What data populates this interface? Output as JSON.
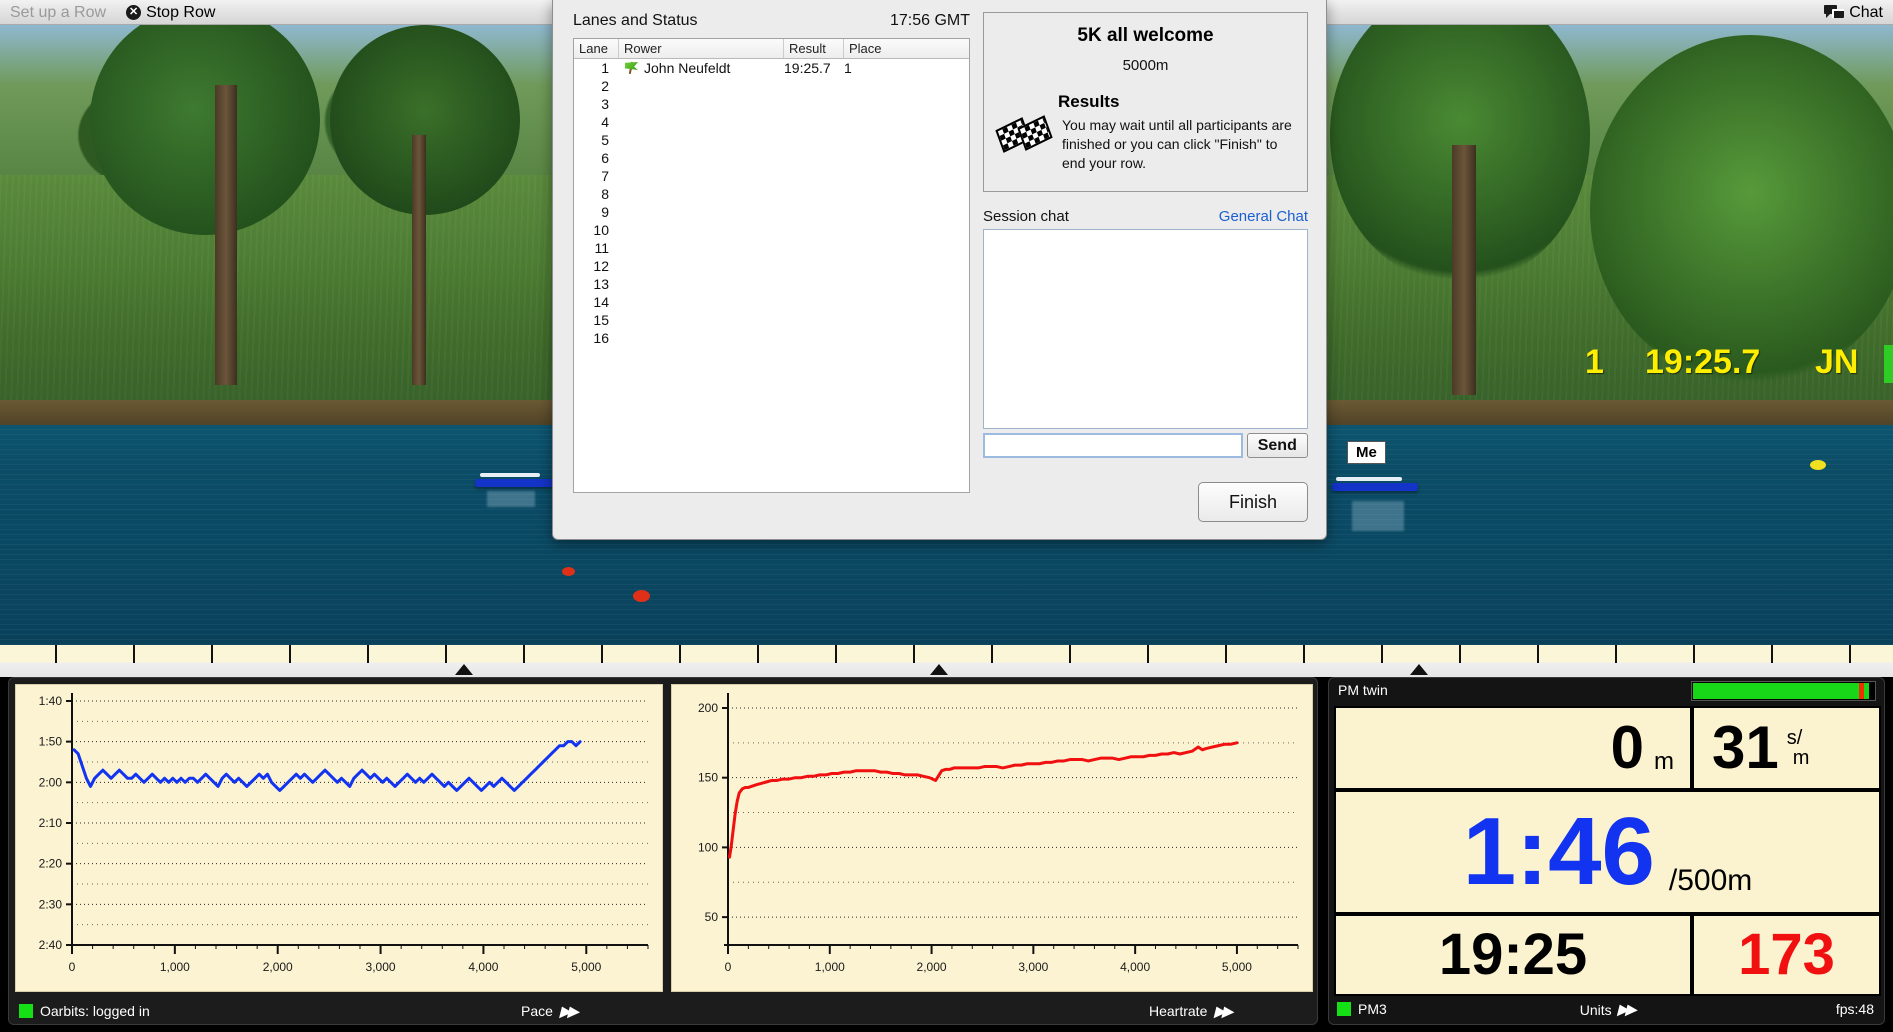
{
  "toolbar": {
    "setup_label": "Set up a Row",
    "stop_label": "Stop Row",
    "stop_icon": "close-circle-icon",
    "chat_label": "Chat",
    "chat_icon": "speech-bubble-icon"
  },
  "scene": {
    "overlay_place": "1",
    "overlay_time": "19:25.7",
    "overlay_initials": "JN",
    "me_label": "Me"
  },
  "dialog": {
    "lanes_title": "Lanes and Status",
    "clock": "17:56 GMT",
    "columns": [
      "Lane",
      "Rower",
      "Result",
      "Place"
    ],
    "rows": [
      {
        "lane": "1",
        "rower": "John Neufeldt",
        "result": "19:25.7",
        "place": "1",
        "flag": "green-flag-icon"
      },
      {
        "lane": "2",
        "rower": "",
        "result": "",
        "place": "",
        "flag": ""
      },
      {
        "lane": "3",
        "rower": "",
        "result": "",
        "place": "",
        "flag": ""
      },
      {
        "lane": "4",
        "rower": "",
        "result": "",
        "place": "",
        "flag": ""
      },
      {
        "lane": "5",
        "rower": "",
        "result": "",
        "place": "",
        "flag": ""
      },
      {
        "lane": "6",
        "rower": "",
        "result": "",
        "place": "",
        "flag": ""
      },
      {
        "lane": "7",
        "rower": "",
        "result": "",
        "place": "",
        "flag": ""
      },
      {
        "lane": "8",
        "rower": "",
        "result": "",
        "place": "",
        "flag": ""
      },
      {
        "lane": "9",
        "rower": "",
        "result": "",
        "place": "",
        "flag": ""
      },
      {
        "lane": "10",
        "rower": "",
        "result": "",
        "place": "",
        "flag": ""
      },
      {
        "lane": "11",
        "rower": "",
        "result": "",
        "place": "",
        "flag": ""
      },
      {
        "lane": "12",
        "rower": "",
        "result": "",
        "place": "",
        "flag": ""
      },
      {
        "lane": "13",
        "rower": "",
        "result": "",
        "place": "",
        "flag": ""
      },
      {
        "lane": "14",
        "rower": "",
        "result": "",
        "place": "",
        "flag": ""
      },
      {
        "lane": "15",
        "rower": "",
        "result": "",
        "place": "",
        "flag": ""
      },
      {
        "lane": "16",
        "rower": "",
        "result": "",
        "place": "",
        "flag": ""
      }
    ],
    "race_title": "5K all welcome",
    "race_distance": "5000m",
    "results_heading": "Results",
    "results_text": "You may wait until all participants are finished or you can click \"Finish\" to end your row.",
    "results_icon": "checkered-flags-icon",
    "session_chat_label": "Session chat",
    "general_chat_label": "General Chat",
    "chat_log_text": "",
    "chat_input_value": "",
    "chat_input_placeholder": "",
    "send_label": "Send",
    "finish_label": "Finish"
  },
  "charts": {
    "pace_footer_label": "Pace",
    "heartrate_footer_label": "Heartrate",
    "status_label": "Oarbits: logged in",
    "status_icon": "green-status-square",
    "forward_icon": "double-arrow-icon"
  },
  "pm": {
    "title": "PM twin",
    "distance_value": "0",
    "distance_unit": "m",
    "rate_value": "31",
    "rate_unit_top": "s/",
    "rate_unit_bottom": "m",
    "pace_value": "1:46",
    "pace_unit": "/500m",
    "time_value": "19:25",
    "hr_value": "173",
    "footer_device": "PM3",
    "footer_units": "Units",
    "footer_fps": "fps:48",
    "footer_icon": "green-status-square",
    "units_icon": "double-arrow-icon",
    "bar_fill_percent": 96,
    "colors": {
      "pace": "#1233f0",
      "hr": "#f01010",
      "bar": "#18d718",
      "mark": "#f03000"
    }
  },
  "chart_data": [
    {
      "type": "line",
      "title": "Pace",
      "xlabel": "",
      "ylabel": "",
      "xlim": [
        0,
        5600
      ],
      "ylim": [
        100,
        160
      ],
      "y_inverted": true,
      "grid": true,
      "legend": null,
      "color": "#1233f0",
      "xticks": [
        0,
        1000,
        2000,
        3000,
        4000,
        5000
      ],
      "xticklabels": [
        "0",
        "1,000",
        "2,000",
        "3,000",
        "4,000",
        "5,000"
      ],
      "yticks": [
        100,
        110,
        120,
        130,
        140,
        150,
        160
      ],
      "yticklabels": [
        "1:40",
        "1:50",
        "2:00",
        "2:10",
        "2:20",
        "2:30",
        "2:40"
      ],
      "x": [
        20,
        60,
        100,
        140,
        180,
        220,
        260,
        300,
        340,
        380,
        420,
        460,
        500,
        540,
        580,
        620,
        660,
        700,
        740,
        780,
        820,
        860,
        900,
        940,
        980,
        1020,
        1060,
        1100,
        1140,
        1180,
        1220,
        1260,
        1300,
        1340,
        1380,
        1420,
        1460,
        1500,
        1540,
        1580,
        1620,
        1660,
        1700,
        1740,
        1780,
        1820,
        1860,
        1900,
        1940,
        1980,
        2020,
        2060,
        2100,
        2140,
        2180,
        2220,
        2260,
        2300,
        2340,
        2380,
        2420,
        2460,
        2500,
        2540,
        2580,
        2620,
        2660,
        2700,
        2740,
        2780,
        2820,
        2860,
        2900,
        2940,
        2980,
        3020,
        3060,
        3100,
        3140,
        3180,
        3220,
        3260,
        3300,
        3340,
        3380,
        3420,
        3460,
        3500,
        3540,
        3580,
        3620,
        3660,
        3700,
        3740,
        3780,
        3820,
        3860,
        3900,
        3940,
        3980,
        4020,
        4060,
        4100,
        4140,
        4180,
        4220,
        4260,
        4300,
        4340,
        4380,
        4420,
        4460,
        4500,
        4540,
        4580,
        4620,
        4660,
        4700,
        4740,
        4780,
        4820,
        4860,
        4900,
        4940,
        4980,
        5000
      ],
      "y": [
        112,
        113,
        116,
        119,
        121,
        119,
        118,
        117,
        118,
        119,
        118,
        117,
        118,
        119,
        119,
        118,
        119,
        120,
        119,
        118,
        119,
        120,
        119,
        120,
        119,
        120,
        119,
        120,
        119,
        119,
        120,
        119,
        118,
        119,
        120,
        121,
        119,
        118,
        119,
        120,
        119,
        120,
        121,
        120,
        119,
        118,
        119,
        118,
        120,
        121,
        122,
        121,
        120,
        119,
        118,
        119,
        118,
        119,
        120,
        119,
        118,
        117,
        118,
        119,
        120,
        119,
        120,
        121,
        119,
        118,
        117,
        118,
        119,
        118,
        119,
        120,
        119,
        120,
        121,
        120,
        119,
        118,
        119,
        120,
        119,
        120,
        119,
        118,
        119,
        120,
        121,
        120,
        121,
        122,
        121,
        120,
        119,
        120,
        121,
        122,
        121,
        120,
        121,
        120,
        119,
        120,
        121,
        122,
        121,
        120,
        119,
        118,
        117,
        116,
        115,
        114,
        113,
        112,
        111,
        111,
        110,
        110,
        111,
        110
      ]
    },
    {
      "type": "line",
      "title": "Heartrate",
      "xlabel": "",
      "ylabel": "",
      "xlim": [
        0,
        5600
      ],
      "ylim": [
        30,
        205
      ],
      "grid": true,
      "legend": null,
      "color": "#f01010",
      "xticks": [
        0,
        1000,
        2000,
        3000,
        4000,
        5000
      ],
      "xticklabels": [
        "0",
        "1,000",
        "2,000",
        "3,000",
        "4,000",
        "5,000"
      ],
      "yticks": [
        50,
        100,
        150,
        200
      ],
      "yticklabels": [
        "50",
        "100",
        "150",
        "200"
      ],
      "x": [
        15,
        30,
        50,
        70,
        90,
        110,
        140,
        170,
        200,
        240,
        280,
        330,
        380,
        430,
        480,
        540,
        600,
        660,
        720,
        780,
        840,
        900,
        960,
        1020,
        1080,
        1140,
        1200,
        1260,
        1320,
        1380,
        1440,
        1500,
        1560,
        1620,
        1680,
        1740,
        1800,
        1860,
        1920,
        1980,
        2040,
        2100,
        2140,
        2180,
        2220,
        2280,
        2340,
        2400,
        2460,
        2520,
        2580,
        2640,
        2700,
        2760,
        2820,
        2880,
        2940,
        3000,
        3060,
        3120,
        3180,
        3240,
        3300,
        3360,
        3420,
        3480,
        3540,
        3600,
        3660,
        3720,
        3780,
        3840,
        3900,
        3960,
        4020,
        4080,
        4140,
        4200,
        4260,
        4320,
        4380,
        4440,
        4500,
        4560,
        4620,
        4660,
        4700,
        4760,
        4820,
        4880,
        4940,
        5000
      ],
      "y": [
        93,
        100,
        112,
        124,
        133,
        139,
        142,
        143,
        143,
        144,
        145,
        146,
        147,
        148,
        148,
        149,
        149,
        150,
        150,
        151,
        151,
        152,
        152,
        153,
        153,
        154,
        154,
        155,
        155,
        155,
        155,
        154,
        154,
        153,
        153,
        152,
        152,
        152,
        151,
        150,
        148,
        155,
        156,
        156,
        157,
        157,
        157,
        157,
        157,
        158,
        158,
        158,
        157,
        158,
        159,
        159,
        160,
        160,
        160,
        161,
        161,
        162,
        162,
        163,
        163,
        163,
        162,
        163,
        164,
        164,
        164,
        163,
        164,
        165,
        165,
        165,
        166,
        166,
        167,
        167,
        168,
        167,
        168,
        169,
        172,
        170,
        171,
        172,
        173,
        174,
        174,
        175
      ]
    }
  ]
}
